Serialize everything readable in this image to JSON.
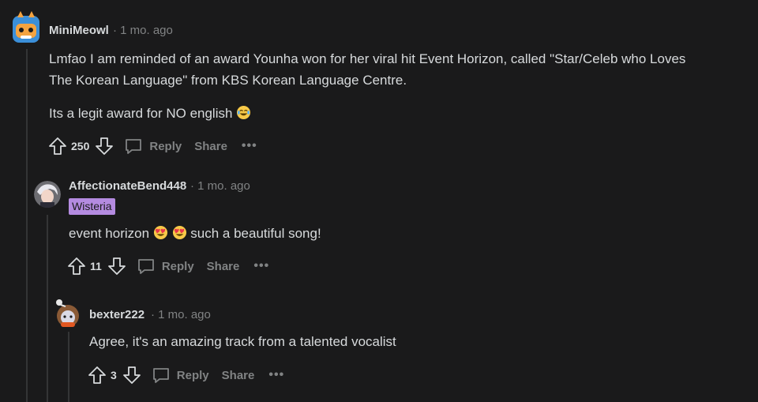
{
  "comments": [
    {
      "username": "MiniMeowl",
      "time": "· 1 mo. ago",
      "body_lines": [
        "Lmfao I am reminded of an award Younha won for her viral hit Event Horizon, called \"Star/Celeb who Loves",
        "The Korean Language\" from KBS Korean Language Centre."
      ],
      "body_line3": "Its a legit award for NO english",
      "score": "250",
      "reply_label": "Reply",
      "share_label": "Share",
      "more_label": "•••"
    },
    {
      "username": "AffectionateBend448",
      "time": "· 1 mo. ago",
      "flair": "Wisteria",
      "body_a": "event horizon",
      "body_b": "such a beautiful song!",
      "score": "11",
      "reply_label": "Reply",
      "share_label": "Share",
      "more_label": "•••"
    },
    {
      "username": "bexter222",
      "time": "· 1 mo. ago",
      "body": "Agree, it's an amazing track from a talented vocalist",
      "score": "3",
      "reply_label": "Reply",
      "share_label": "Share",
      "more_label": "•••"
    }
  ],
  "icons": {
    "upvote": "upvote-icon",
    "downvote": "downvote-icon",
    "reply": "comment-bubble-icon",
    "emoji_laugh": "tears-of-joy-emoji",
    "emoji_heart_eyes": "heart-eyes-emoji"
  },
  "colors": {
    "background": "#1a1a1b",
    "text": "#d7dadc",
    "muted": "#818384",
    "flair": "#b48be0"
  }
}
